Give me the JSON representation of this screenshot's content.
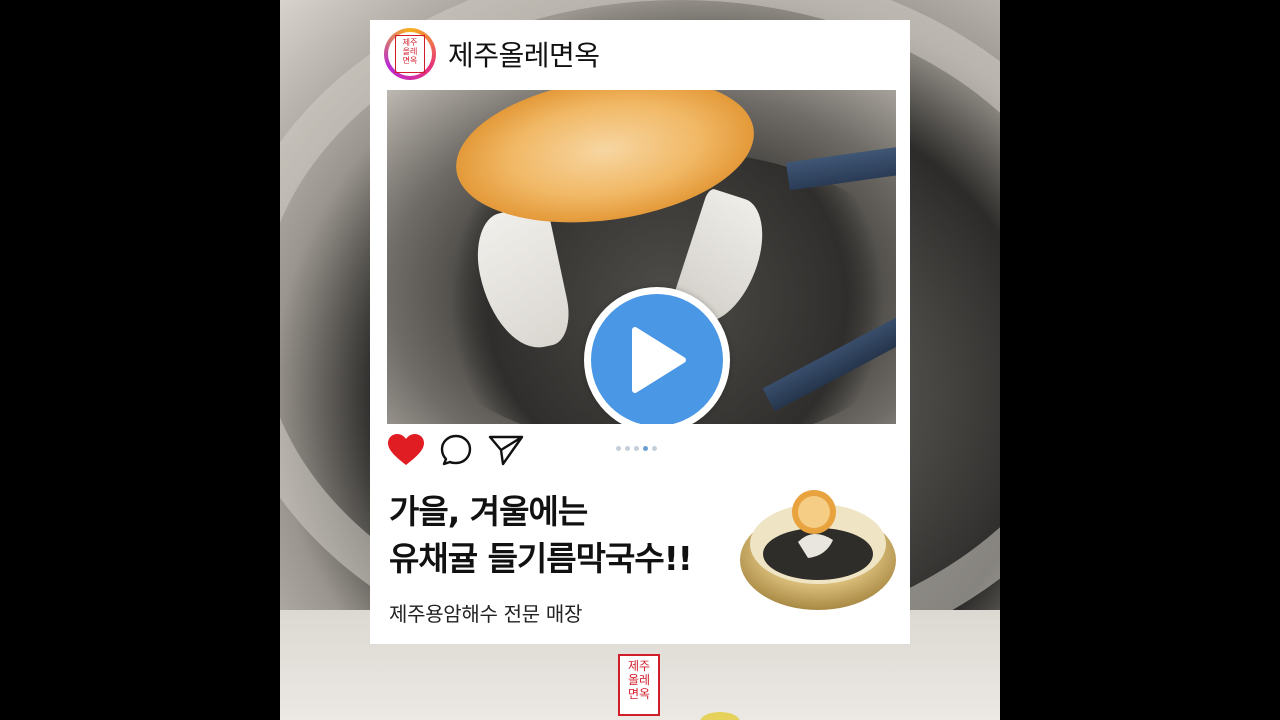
{
  "post": {
    "account_name": "제주올레면옥",
    "headline_line1": "가을, 겨울에는",
    "headline_line2": "유채귤 들기름막국수!!",
    "subline": "제주용암해수 전문 매장",
    "carousel_total": 5,
    "carousel_active_index": 3
  },
  "logo": {
    "stamp_chars": [
      "제주",
      "올레",
      "면옥"
    ]
  },
  "colors": {
    "heart": "#e11d24",
    "play": "#4a97e6",
    "stamp_red": "#d11d2b"
  },
  "icons": [
    "heart-icon",
    "comment-icon",
    "share-icon",
    "play-icon"
  ]
}
